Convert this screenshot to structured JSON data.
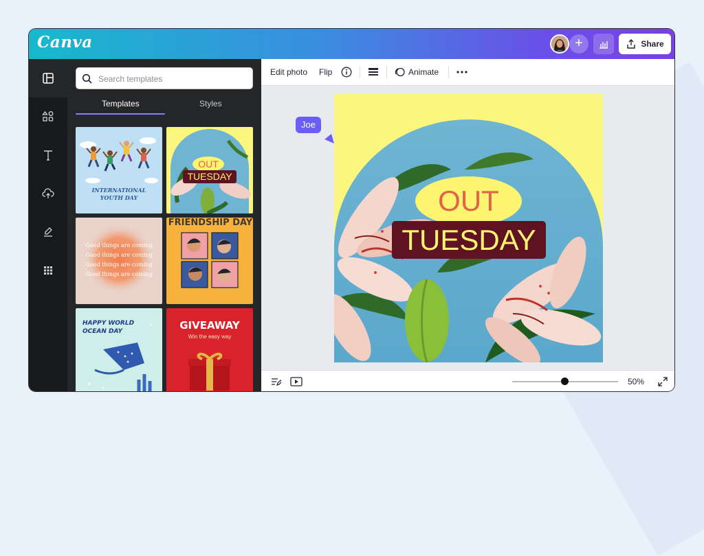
{
  "app": {
    "logo": "Canva"
  },
  "header": {
    "share_label": "Share",
    "plus_symbol": "+"
  },
  "search": {
    "placeholder": "Search templates"
  },
  "panel": {
    "tabs": [
      {
        "label": "Templates",
        "active": true
      },
      {
        "label": "Styles",
        "active": false
      }
    ]
  },
  "templates": [
    {
      "lines": [
        "INTERNATIONAL",
        "YOUTH DAY"
      ]
    },
    {
      "badge": "OUT",
      "title": "TUESDAY"
    },
    {
      "lines": [
        "Good things are coming",
        "Good things are coming",
        "Good things are coming",
        "Good things are coming"
      ]
    },
    {
      "lines": [
        "FRIENDSHIP DAY"
      ]
    },
    {
      "lines": [
        "HAPPY WORLD",
        "OCEAN DAY"
      ]
    },
    {
      "title": "GIVEAWAY",
      "subtitle": "Win the easy way"
    }
  ],
  "toolbar": {
    "edit_photo": "Edit photo",
    "flip": "Flip",
    "animate": "Animate"
  },
  "canvas": {
    "badge": "OUT",
    "title": "TUESDAY",
    "cursor_label": "Joe"
  },
  "footer": {
    "zoom": "50%",
    "zoom_level": 0.5
  },
  "colors": {
    "accent": "#6b5ef5",
    "title_bg": "#5e1222",
    "title_text": "#fdf56f",
    "badge_bg": "#fdf56f",
    "badge_text": "#e5604a",
    "page_bg": "#fbf77e",
    "sky": "#6fb4d3"
  }
}
